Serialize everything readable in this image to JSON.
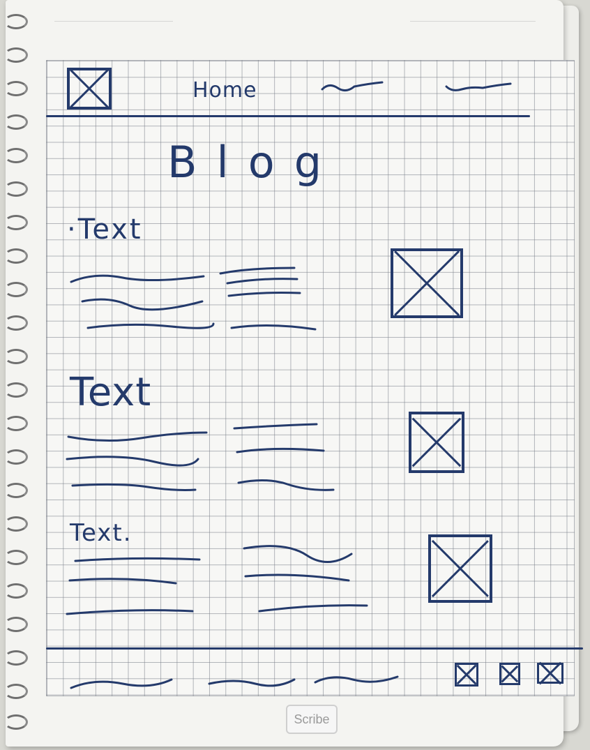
{
  "nav": {
    "home_label": "Home"
  },
  "page_title": "Blog",
  "posts": [
    {
      "title": "·Text"
    },
    {
      "title": "Text"
    },
    {
      "title": "Text."
    }
  ],
  "watermark": "Scribe",
  "colors": {
    "ink": "#243a6b",
    "grid": "#787d87",
    "paper": "#f4f4f1"
  }
}
